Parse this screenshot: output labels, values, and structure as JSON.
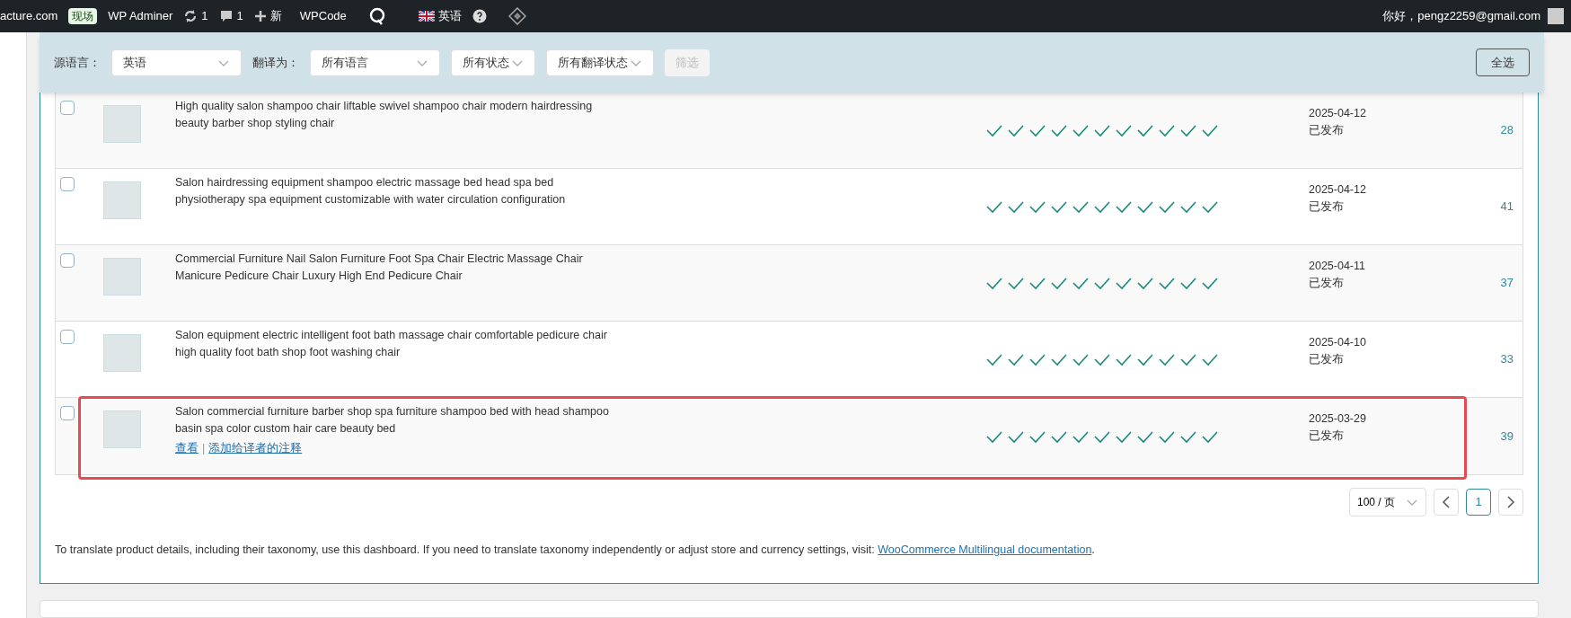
{
  "admin_bar": {
    "site": "acture.com",
    "env_badge": "现场",
    "adminer": "WP Adminer",
    "updates": "1",
    "comments": "1",
    "new": "新",
    "wpcode": "WPCode",
    "language": "英语",
    "greeting": "你好，pengz2259@gmail.com"
  },
  "filters": {
    "source_label": "源语言：",
    "source": "英语",
    "target_label": "翻译为：",
    "target": "所有语言",
    "status": "所有状态",
    "translation_status": "所有翻译状态",
    "filter_button": {
      "label": "筛选",
      "disabled": true
    },
    "select_all": "全选"
  },
  "rows": [
    {
      "checked": false,
      "title": "High quality salon shampoo chair liftable swivel shampoo chair modern hairdressing beauty barber shop styling chair",
      "translations": [
        {
          "complete": true
        },
        {
          "complete": true
        },
        {
          "complete": true
        },
        {
          "complete": true
        },
        {
          "complete": true
        },
        {
          "complete": true
        },
        {
          "complete": true
        },
        {
          "complete": true
        },
        {
          "complete": true
        },
        {
          "complete": true
        },
        {
          "complete": true
        }
      ],
      "date": "2025-04-12",
      "state": "已发布",
      "count": "28",
      "highlighted": false
    },
    {
      "checked": false,
      "title": "Salon hairdressing equipment shampoo electric massage bed head spa bed physiotherapy spa equipment customizable with water circulation configuration",
      "translations": [
        {
          "complete": true
        },
        {
          "complete": true
        },
        {
          "complete": true
        },
        {
          "complete": true
        },
        {
          "complete": true
        },
        {
          "complete": true
        },
        {
          "complete": true
        },
        {
          "complete": true
        },
        {
          "complete": true
        },
        {
          "complete": true
        },
        {
          "complete": true
        }
      ],
      "date": "2025-04-12",
      "state": "已发布",
      "count": "41",
      "highlighted": false
    },
    {
      "checked": false,
      "title": "Commercial Furniture Nail Salon Furniture Foot Spa Chair Electric Massage Chair Manicure Pedicure Chair Luxury High End Pedicure Chair",
      "translations": [
        {
          "complete": true
        },
        {
          "complete": true
        },
        {
          "complete": true
        },
        {
          "complete": true
        },
        {
          "complete": true
        },
        {
          "complete": true
        },
        {
          "complete": true
        },
        {
          "complete": true
        },
        {
          "complete": true
        },
        {
          "complete": true
        },
        {
          "complete": true
        }
      ],
      "date": "2025-04-11",
      "state": "已发布",
      "count": "37",
      "highlighted": false
    },
    {
      "checked": false,
      "title": "Salon equipment electric intelligent foot bath massage chair comfortable pedicure chair high quality foot bath shop foot washing chair",
      "translations": [
        {
          "complete": true
        },
        {
          "complete": true
        },
        {
          "complete": true
        },
        {
          "complete": true
        },
        {
          "complete": true
        },
        {
          "complete": true
        },
        {
          "complete": true
        },
        {
          "complete": true
        },
        {
          "complete": true
        },
        {
          "complete": true
        },
        {
          "complete": true
        }
      ],
      "date": "2025-04-10",
      "state": "已发布",
      "count": "33",
      "highlighted": false
    },
    {
      "checked": false,
      "title": "Salon commercial furniture barber shop spa furniture shampoo bed with head shampoo basin spa color custom hair care beauty bed",
      "translations": [
        {
          "complete": true
        },
        {
          "complete": true
        },
        {
          "complete": true
        },
        {
          "complete": true
        },
        {
          "complete": true
        },
        {
          "complete": true
        },
        {
          "complete": true
        },
        {
          "complete": true
        },
        {
          "complete": true
        },
        {
          "complete": true
        },
        {
          "complete": true
        }
      ],
      "date": "2025-03-29",
      "state": "已发布",
      "count": "39",
      "highlighted": true,
      "actions": {
        "items": [
          "查看",
          "添加给译者的注释"
        ],
        "separator": "|"
      }
    }
  ],
  "pagination": {
    "per_page": "100 / 页",
    "pages": [
      {
        "label": "1",
        "selected": true
      }
    ]
  },
  "footer": {
    "text": "To translate product details, including their taxonomy, use this dashboard. If you need to translate taxonomy independently or adjust store and currency settings, visit: ",
    "link": "WooCommerce Multilingual documentation",
    "end": "."
  }
}
